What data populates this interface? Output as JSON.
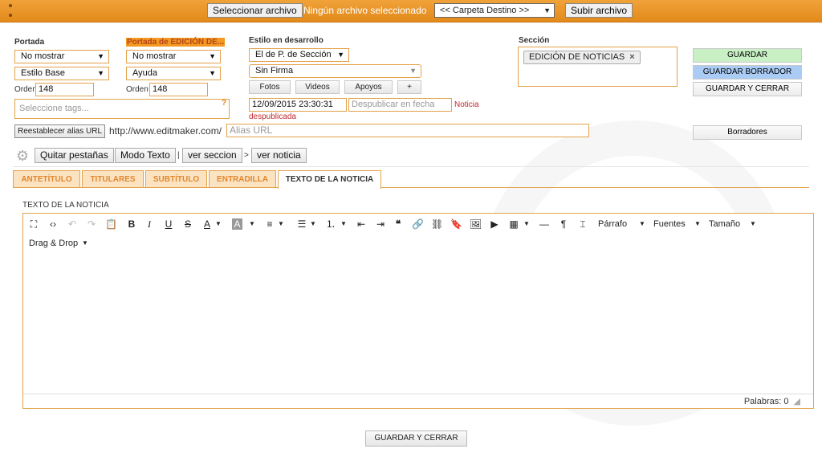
{
  "upload": {
    "select_file_label": "Seleccionar archivo",
    "no_file_text": "Ningún archivo seleccionado",
    "destination": "<< Carpeta Destino >>",
    "upload_label": "Subir archivo"
  },
  "portada": {
    "label": "Portada",
    "visibility": "No mostrar",
    "style": "Estilo Base",
    "order_label": "Orden",
    "order_value": "148"
  },
  "portada_edicion": {
    "label": "Portada de EDICIÓN DE...",
    "visibility": "No mostrar",
    "style": "Ayuda",
    "order_label": "Orden",
    "order_value": "148"
  },
  "tags": {
    "placeholder": "Seleccione tags...",
    "help": "?"
  },
  "estilo": {
    "label": "Estilo en desarrollo",
    "value": "El de P. de Sección",
    "firma": "Sin Firma",
    "buttons": {
      "fotos": "Fotos",
      "videos": "Videos",
      "apoyos": "Apoyos",
      "plus": "+"
    },
    "date": "12/09/2015 23:30:31",
    "unpublish_placeholder": "Despublicar en fecha",
    "status_line1": "Noticia",
    "status_line2": "despublicada"
  },
  "seccion": {
    "label": "Sección",
    "chip": "EDICIÓN DE NOTICIAS",
    "chip_remove": "×"
  },
  "actions": {
    "guardar": "GUARDAR",
    "guardar_borrador": "GUARDAR BORRADOR",
    "guardar_cerrar": "GUARDAR Y CERRAR",
    "borradores": "Borradores",
    "colors": {
      "guardar_bg": "#c8f0c4",
      "borrador_bg": "#aaccf4"
    }
  },
  "alias": {
    "reset_label": "Reestablecer alias URL",
    "base_url": "http://www.editmaker.com/",
    "placeholder": "Alias URL"
  },
  "toolbar": {
    "quitar": "Quitar pestañas",
    "modo_texto": "Modo Texto",
    "sep1": "|",
    "ver_seccion": "ver seccion",
    "sep2": ">",
    "ver_noticia": "ver noticia"
  },
  "tabs": [
    {
      "label": "ANTETÍTULO"
    },
    {
      "label": "TITULARES"
    },
    {
      "label": "SUBTÍTULO"
    },
    {
      "label": "ENTRADILLA"
    },
    {
      "label": "TEXTO DE LA NOTICIA"
    }
  ],
  "editor": {
    "heading": "TEXTO DE LA NOTICIA",
    "parrafo": "Párrafo",
    "fuentes": "Fuentes",
    "tamano": "Tamaño",
    "drag_drop": "Drag & Drop",
    "word_count": "Palabras: 0"
  },
  "footer": {
    "guardar_cerrar": "GUARDAR Y CERRAR"
  },
  "colors": {
    "accent": "#e3a24a",
    "topbar": "#e8901f",
    "status_red": "#c0282d"
  }
}
